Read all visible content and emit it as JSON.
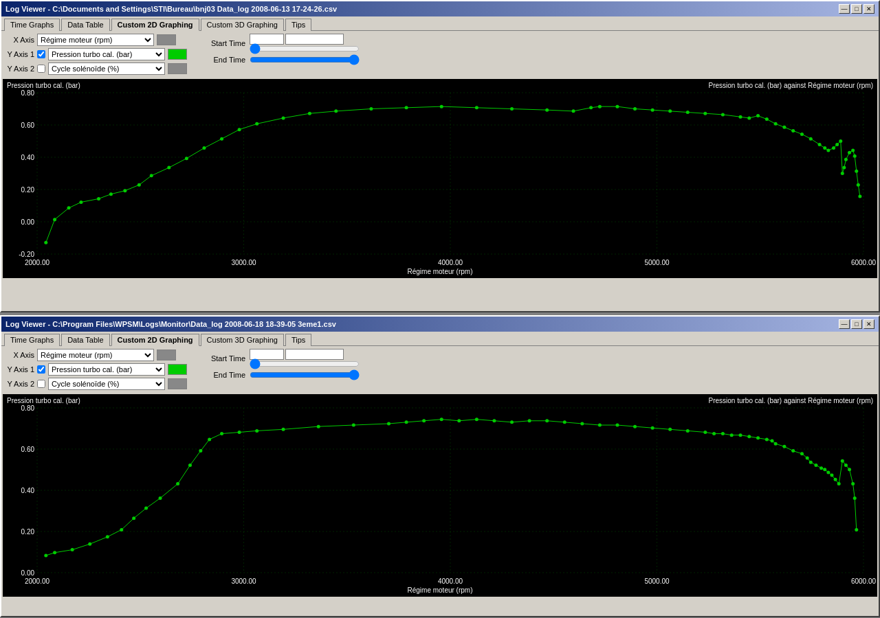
{
  "window1": {
    "title": "Log Viewer - C:\\Documents and Settings\\STI\\Bureau\\bnj03 Data_log 2008-06-13 17-24-26.csv",
    "tabs": [
      "Time Graphs",
      "Data Table",
      "Custom 2D Graphing",
      "Custom 3D Graphing",
      "Tips"
    ],
    "active_tab": "Custom 2D Graphing",
    "xaxis_label": "X Axis",
    "yaxis1_label": "Y Axis 1",
    "yaxis2_label": "Y Axis 2",
    "xaxis_value": "Régime moteur (rpm)",
    "yaxis1_value": "Pression turbo cal. (bar)",
    "yaxis2_value": "Cycle solénoïde (%)",
    "yaxis1_checked": true,
    "yaxis2_checked": false,
    "start_time_label": "Start Time",
    "end_time_label": "End Time",
    "chart_left_label": "Pression turbo cal. (bar)",
    "chart_right_label": "Pression turbo cal. (bar) against Régime moteur (rpm)",
    "chart_bottom_label": "Régime moteur (rpm)"
  },
  "window2": {
    "title": "Log Viewer - C:\\Program Files\\WPSM\\Logs\\Monitor\\Data_log 2008-06-18 18-39-05 3eme1.csv",
    "tabs": [
      "Time Graphs",
      "Data Table",
      "Custom 2D Graphing",
      "Custom 3D Graphing",
      "Tips"
    ],
    "active_tab": "Custom 2D Graphing",
    "xaxis_label": "X Axis",
    "yaxis1_label": "Y Axis 1",
    "yaxis2_label": "Y Axis 2",
    "xaxis_value": "Régime moteur (rpm)",
    "yaxis1_value": "Pression turbo cal. (bar)",
    "yaxis2_value": "Cycle solénoïde (%)",
    "yaxis1_checked": true,
    "yaxis2_checked": false,
    "start_time_label": "Start Time",
    "end_time_label": "End Time",
    "chart_left_label": "Pression turbo cal. (bar)",
    "chart_right_label": "Pression turbo cal. (bar) against Régime moteur (rpm)",
    "chart_bottom_label": "Régime moteur (rpm)"
  },
  "controls": {
    "minimize": "—",
    "maximize": "□",
    "close": "✕"
  }
}
